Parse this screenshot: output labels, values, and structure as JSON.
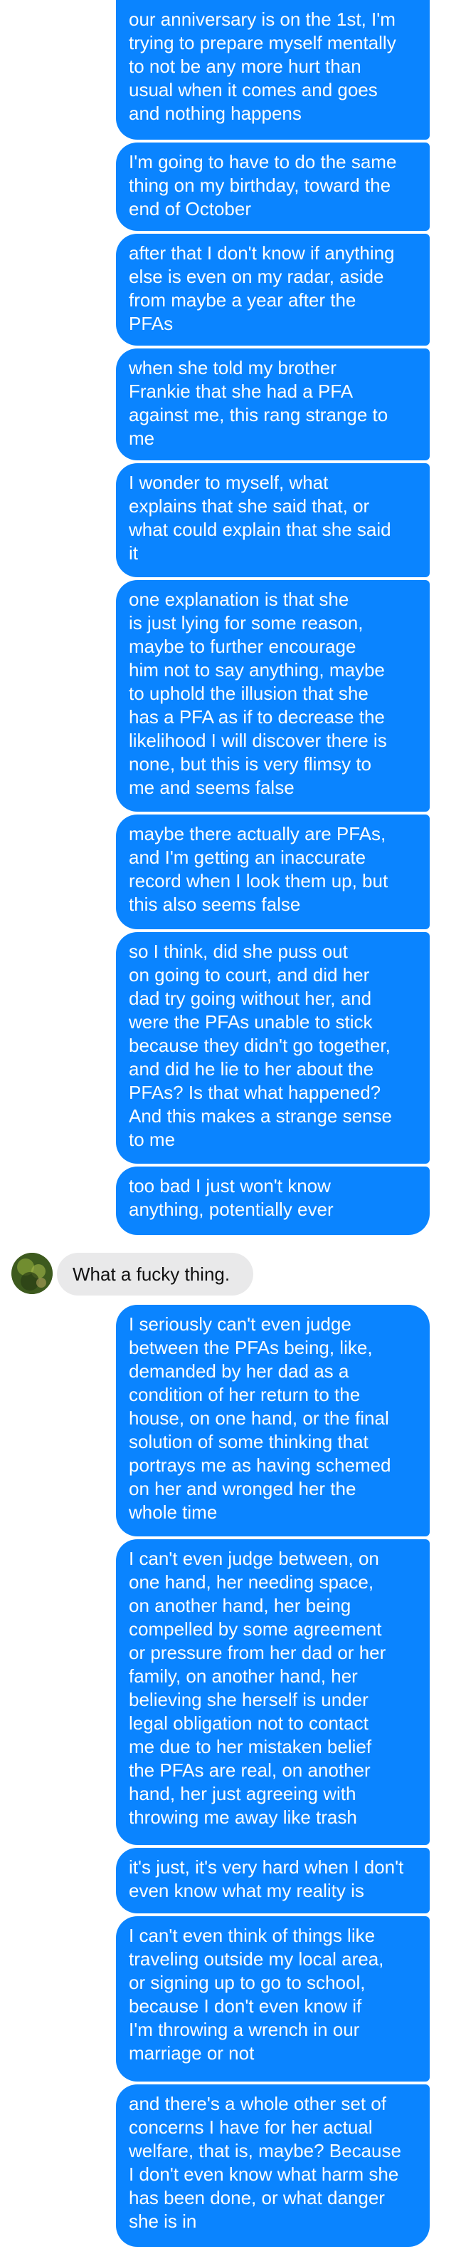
{
  "messages": [
    {
      "sender": "me",
      "text": "our anniversary is on the 1st, I'm trying to prepare myself mentally to not be any more hurt than usual when it comes and goes and nothing happens"
    },
    {
      "sender": "me",
      "text": "I'm going to have to do the same thing on my birthday, toward the end of October"
    },
    {
      "sender": "me",
      "text": "after that I don't know if anything else is even on my radar, aside from maybe a year after the PFAs"
    },
    {
      "sender": "me",
      "text": "when she told my brother Frankie that she had a PFA against me, this rang strange to me"
    },
    {
      "sender": "me",
      "text": "I wonder to myself, what explains that she said that, or what could explain that she said it"
    },
    {
      "sender": "me",
      "text": "one explanation is that she is just lying for some reason, maybe to further encourage him not to say anything, maybe to uphold the illusion that she has a PFA as if to decrease the likelihood I will discover there is none, but this is very flimsy to me and seems false"
    },
    {
      "sender": "me",
      "text": "maybe there actually are PFAs, and I'm getting an inaccurate record when I look them up, but this also seems false"
    },
    {
      "sender": "me",
      "text": "so I think, did she puss out on going to court, and did her dad try going without her, and were the PFAs unable to stick because they didn't go together, and did he lie to her about the PFAs? Is that what happened? And this makes a strange sense to me"
    },
    {
      "sender": "me",
      "text": "too bad I just won't know anything, potentially ever"
    },
    {
      "sender": "other",
      "text": "What a fucky thing."
    },
    {
      "sender": "me",
      "text": "I seriously can't even judge between the PFAs being, like, demanded by her dad as a condition of her return to the house, on one hand, or the final solution of some thinking that portrays me as having schemed on her and wronged her the whole time"
    },
    {
      "sender": "me",
      "text": "I can't even judge between, on one hand, her needing space, on another hand, her being compelled by some agreement or pressure from her dad or her family, on another hand, her believing she herself is under legal obligation not to contact me due to her mistaken belief the PFAs are real, on another hand, her just agreeing with throwing me away like trash"
    },
    {
      "sender": "me",
      "text": "it's just, it's very hard when I don't even know what my reality is"
    },
    {
      "sender": "me",
      "text": "I can't even think of things like traveling outside my local area, or signing up to go to school, because I don't even know if I'm throwing a wrench in our marriage or not"
    },
    {
      "sender": "me",
      "text": "and there's a whole other set of concerns I have for her actual welfare, that is, maybe? Because I don't even know what harm she has been done, or what danger she is in"
    }
  ],
  "colors": {
    "outgoing_bubble": "#0a84ff",
    "outgoing_text": "#ffffff",
    "incoming_bubble": "#e9e9ea",
    "incoming_text": "#111111"
  },
  "icons": {
    "avatar": "contact-avatar"
  }
}
